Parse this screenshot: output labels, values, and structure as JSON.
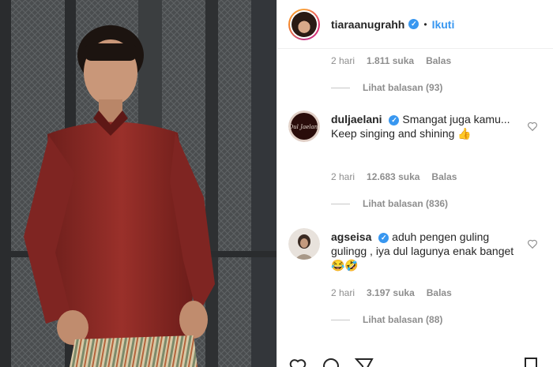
{
  "header": {
    "username": "tiaraanugrahh",
    "follow_label": "Ikuti",
    "dot": "•"
  },
  "top_meta": {
    "time": "2 hari",
    "likes": "1.811 suka",
    "reply": "Balas"
  },
  "top_replies": "Lihat balasan (93)",
  "comments": [
    {
      "username": "duljaelani",
      "text": "Smangat juga kamu... Keep singing and shining 👍",
      "time": "2 hari",
      "likes": "12.683 suka",
      "reply": "Balas",
      "view_replies": "Lihat balasan (836)",
      "avatar_logo": "Dul Jaelani"
    },
    {
      "username": "agseisa",
      "text": "aduh pengen guling gulingg , iya dul lagunya enak banget 😂🤣",
      "time": "2 hari",
      "likes": "3.197 suka",
      "reply": "Balas",
      "view_replies": "Lihat balasan (88)"
    }
  ],
  "icons": {
    "verified": "verified-badge-icon",
    "heart": "heart-outline-icon",
    "comment": "comment-icon",
    "share": "share-icon",
    "save": "bookmark-icon"
  },
  "colors": {
    "accent": "#3897f0",
    "muted": "#8e8e8e",
    "text": "#262626",
    "shirt": "#8b2a26"
  }
}
